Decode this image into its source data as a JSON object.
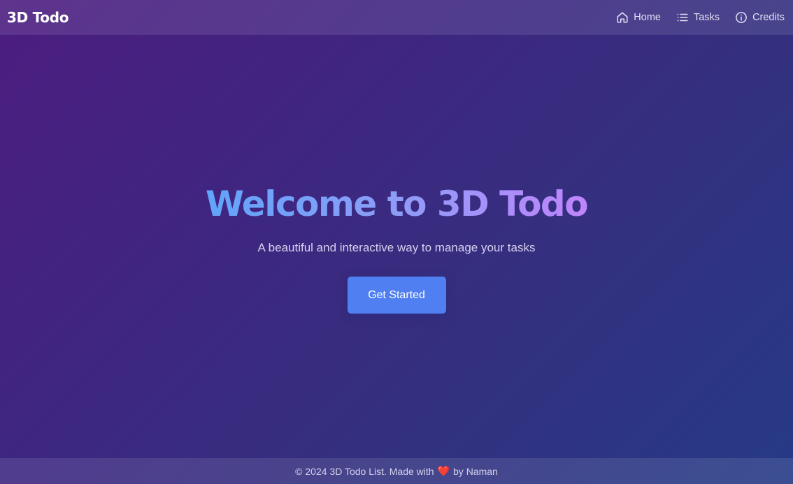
{
  "navbar": {
    "brand": "3D Todo",
    "links": [
      {
        "label": "Home",
        "icon": "home-icon"
      },
      {
        "label": "Tasks",
        "icon": "list-icon"
      },
      {
        "label": "Credits",
        "icon": "info-icon"
      }
    ]
  },
  "hero": {
    "title": "Welcome to 3D Todo",
    "subtitle": "A beautiful and interactive way to manage your tasks",
    "cta_label": "Get Started"
  },
  "footer": {
    "text_before": "© 2024 3D Todo List. Made with",
    "heart": "❤️",
    "text_after": "by Naman"
  },
  "colors": {
    "accent": "#4f7ff0",
    "title_gradient_start": "#60a5fa",
    "title_gradient_end": "#c084fc",
    "heart": "#d9534f"
  }
}
